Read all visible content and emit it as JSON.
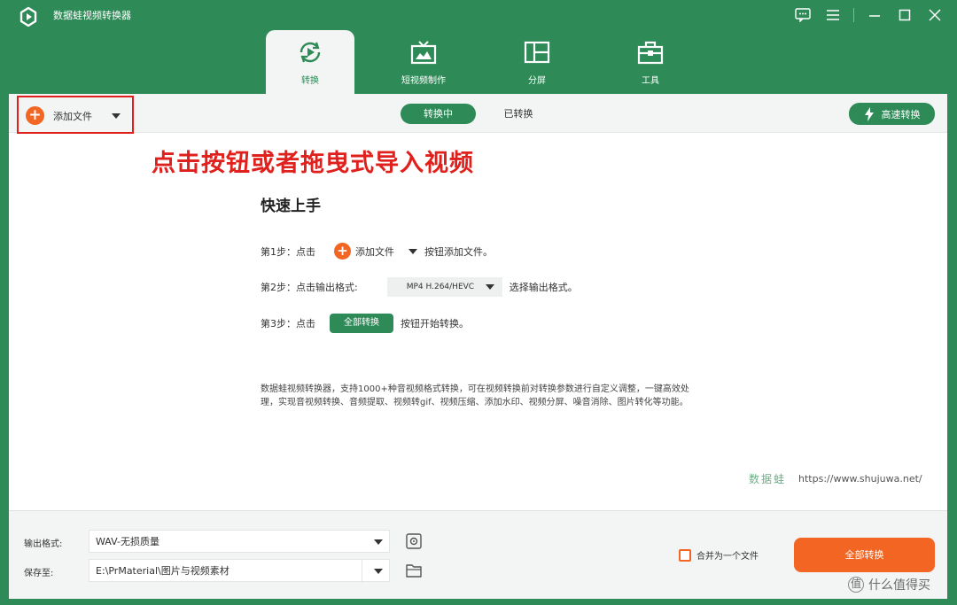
{
  "app": {
    "title": "数据蛙视频转换器"
  },
  "tabs": [
    {
      "label": "转换",
      "icon": "convert-icon",
      "active": true
    },
    {
      "label": "短视频制作",
      "icon": "tv-icon",
      "active": false
    },
    {
      "label": "分屏",
      "icon": "split-screen-icon",
      "active": false
    },
    {
      "label": "工具",
      "icon": "toolbox-icon",
      "active": false
    }
  ],
  "toolbar": {
    "add_file_label": "添加文件",
    "seg_active": "转换中",
    "seg_inactive": "已转换",
    "high_speed_label": "高速转换"
  },
  "annotation": "点击按钮或者拖曳式导入视频",
  "quick_start": {
    "title": "快速上手",
    "step1_prefix": "第1步：点击",
    "step1_button": "添加文件",
    "step1_suffix": "按钮添加文件。",
    "step2_prefix": "第2步：点击输出格式:",
    "step2_format": "MP4 H.264/HEVC",
    "step2_suffix": "选择输出格式。",
    "step3_prefix": "第3步：点击",
    "step3_button": "全部转换",
    "step3_suffix": "按钮开始转换。"
  },
  "description": "数据蛙视频转换器，支持1000+种音视频格式转换，可在视频转换前对转换参数进行自定义调整，一键高效处理，实现音视频转换、音频提取、视频转gif、视频压缩、添加水印、视频分屏、噪音消除、图片转化等功能。",
  "watermark": {
    "logo_text": "数据蛙",
    "url": "https://www.shujuwa.net/"
  },
  "bottom": {
    "output_format_label": "输出格式:",
    "output_format_value": "WAV-无损质量",
    "save_to_label": "保存至:",
    "save_to_value": "E:\\PrMaterial\\图片与视频素材",
    "merge_label": "合并为一个文件",
    "convert_all_label": "全部转换"
  },
  "corner_mark": "什么值得买",
  "colors": {
    "brand_green": "#2e8b57",
    "accent_orange": "#f26522",
    "annotation_red": "#e0201c"
  }
}
